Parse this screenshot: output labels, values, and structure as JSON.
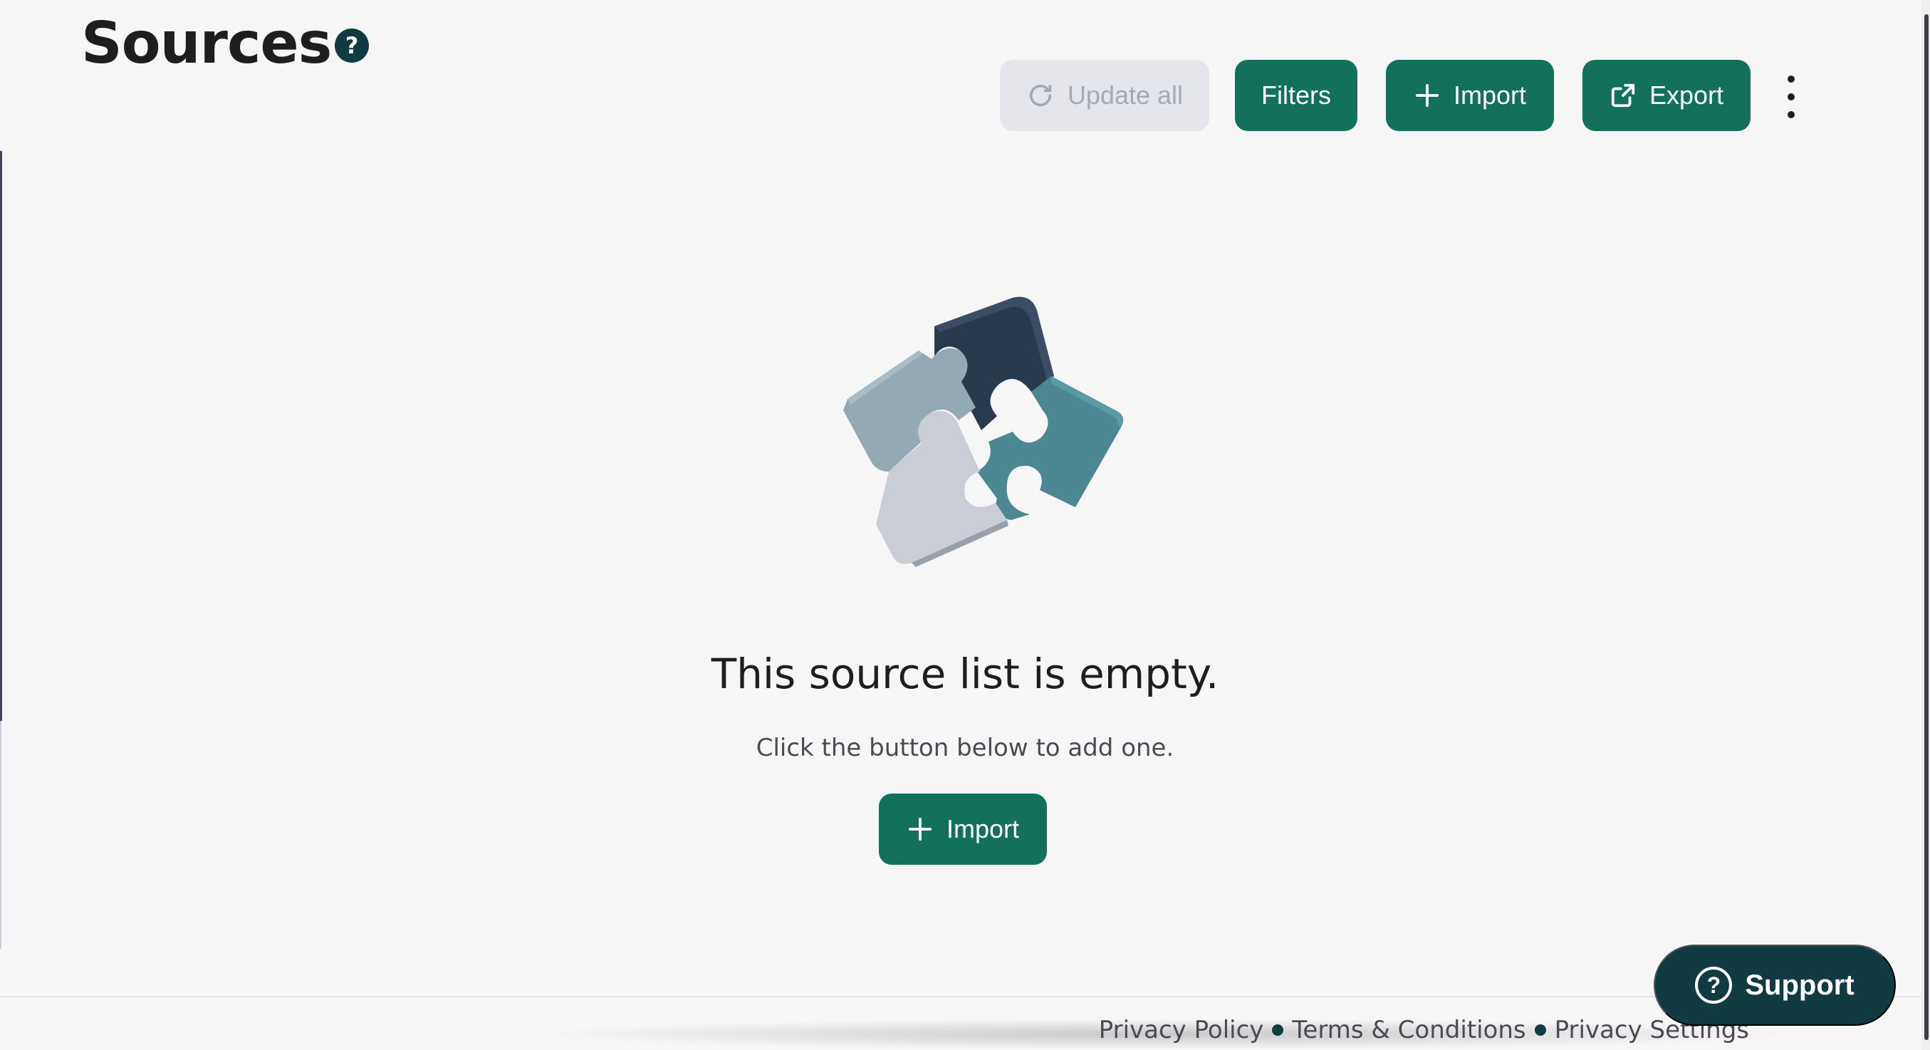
{
  "header": {
    "title": "Sources",
    "help_icon": "question-circle-icon"
  },
  "toolbar": {
    "update_all_label": "Update all",
    "filters_label": "Filters",
    "import_label": "Import",
    "export_label": "Export",
    "more_icon": "kebab-menu-icon"
  },
  "empty_state": {
    "illustration": "puzzle-pieces-illustration",
    "title": "This source list is empty.",
    "subtitle": "Click the button below to add one.",
    "import_label": "Import"
  },
  "footer": {
    "links": [
      "Privacy Policy",
      "Terms & Conditions",
      "Privacy Settings"
    ]
  },
  "support": {
    "label": "Support",
    "icon": "?"
  },
  "colors": {
    "primary": "#12705b",
    "dark": "#0f3b41",
    "disabled_bg": "#e4e6eb",
    "disabled_text": "#a4aab5",
    "background": "#f6f6f7"
  }
}
